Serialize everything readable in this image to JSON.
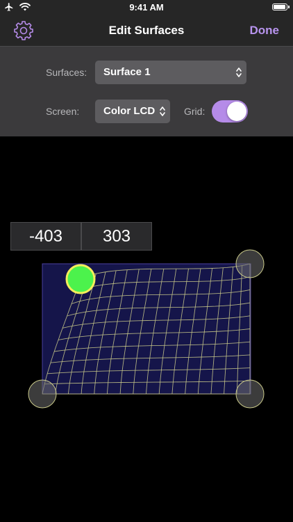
{
  "status_bar": {
    "time": "9:41 AM",
    "airplane_icon": "airplane-icon",
    "wifi_icon": "wifi-icon",
    "battery_icon": "battery-icon",
    "battery_level": 1.0
  },
  "nav": {
    "title": "Edit Surfaces",
    "done_label": "Done",
    "settings_icon": "gear-icon",
    "accent_color": "#b894ee"
  },
  "panel": {
    "surfaces_label": "Surfaces:",
    "surfaces_value": "Surface 1",
    "screen_label": "Screen:",
    "screen_value": "Color LCD",
    "grid_label": "Grid:",
    "grid_on": true,
    "toggle_color": "#b58be8"
  },
  "readout": {
    "x_value": "-403",
    "y_value": "303"
  },
  "surface": {
    "fill_color": "#15154a",
    "grid_color": "#c9c98a",
    "handle_color": "#c9c98a",
    "active_handle_color": "#4cf24c"
  }
}
